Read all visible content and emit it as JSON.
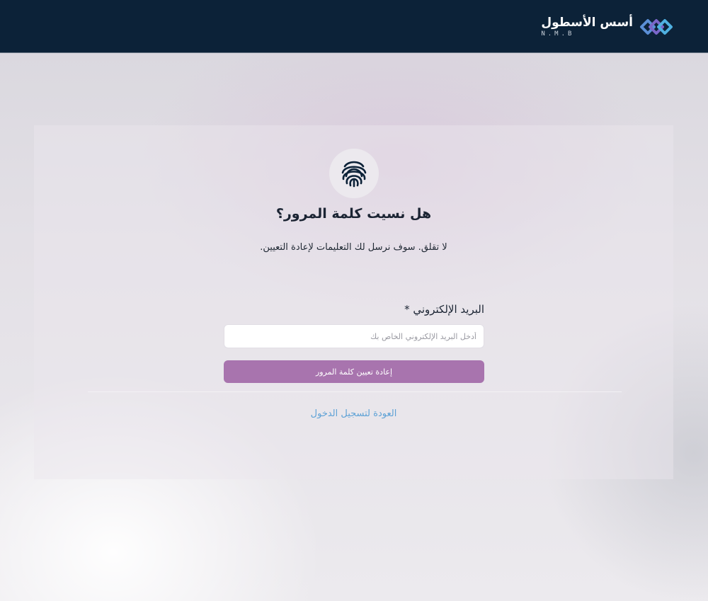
{
  "header": {
    "brand_name": "أسس الأسطول",
    "brand_sub": "N.M.B",
    "logo_icon": "nmb-logo-icon",
    "background_color": "#0c2238"
  },
  "main": {
    "icon": "fingerprint-icon",
    "title": "هل نسيت كلمة المرور؟",
    "subtitle": "لا تقلق. سوف نرسل لك التعليمات لإعادة التعيين.",
    "email_label": "البريد الإلكتروني *",
    "email_placeholder": "أدخل البريد الإلكتروني الخاص بك",
    "email_value": "",
    "submit_label": "إعادة تعيين كلمة المرور",
    "back_link": "العودة لتسجيل الدخول"
  },
  "colors": {
    "accent": "#a874ae",
    "link": "#5ea2d6",
    "text": "#1b2433"
  }
}
